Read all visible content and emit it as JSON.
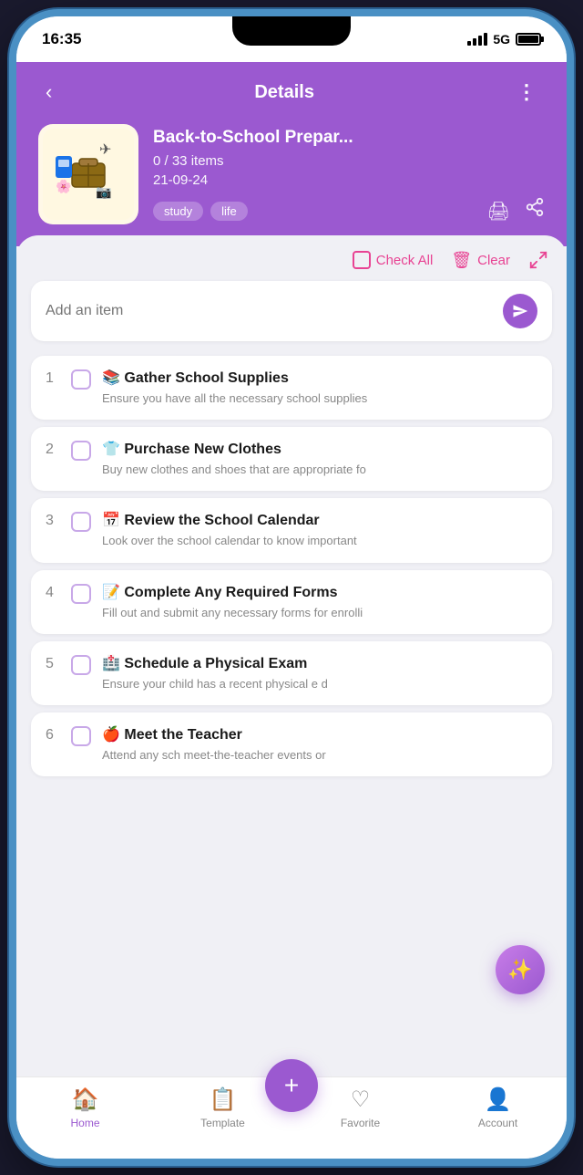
{
  "status_bar": {
    "time": "16:35",
    "signal": "5G"
  },
  "header": {
    "title": "Details",
    "back_label": "‹",
    "more_label": "⋮",
    "list_name": "Back-to-School Prepar...",
    "item_count": "0 / 33 items",
    "date": "21-09-24",
    "tags": [
      "study",
      "life"
    ]
  },
  "toolbar": {
    "check_all_label": "Check All",
    "clear_label": "Clear"
  },
  "add_item": {
    "placeholder": "Add an item"
  },
  "items": [
    {
      "number": "1",
      "emoji": "📚",
      "title": "Gather School Supplies",
      "desc": "Ensure you have all the necessary school supplies"
    },
    {
      "number": "2",
      "emoji": "👕",
      "title": "Purchase New Clothes",
      "desc": "Buy new clothes and shoes that are appropriate fo"
    },
    {
      "number": "3",
      "emoji": "📅",
      "title": "Review the School Calendar",
      "desc": "Look over the school calendar to know important"
    },
    {
      "number": "4",
      "emoji": "📝",
      "title": "Complete Any Required Forms",
      "desc": "Fill out and submit any necessary forms for enrolli"
    },
    {
      "number": "5",
      "emoji": "🏥",
      "title": "Schedule a Physical Exam",
      "desc": "Ensure your child has a recent physical e         d"
    },
    {
      "number": "6",
      "emoji": "🍎",
      "title": "Meet the Teacher",
      "desc": "Attend any sch      meet-the-teacher events or"
    }
  ],
  "bottom_nav": {
    "items": [
      {
        "label": "Home",
        "icon": "🏠",
        "active": true
      },
      {
        "label": "Template",
        "icon": "📋",
        "active": false
      },
      {
        "label": "",
        "icon": "+",
        "active": false,
        "is_add": true
      },
      {
        "label": "Favorite",
        "icon": "♡",
        "active": false
      },
      {
        "label": "Account",
        "icon": "👤",
        "active": false
      }
    ]
  },
  "fab": {
    "icon": "✨"
  },
  "colors": {
    "purple": "#9b59d0",
    "pink": "#e84393",
    "light_bg": "#f0f0f5"
  }
}
